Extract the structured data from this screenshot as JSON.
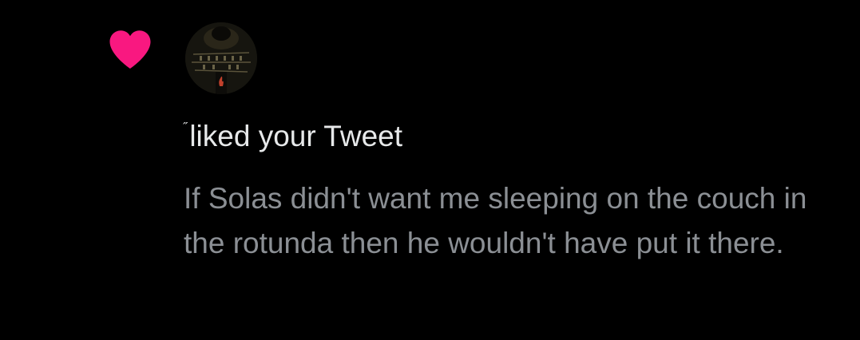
{
  "colors": {
    "heart": "#f91880",
    "primary_text": "#e7e9ea",
    "secondary_text": "#8b8f94",
    "background": "#000000"
  },
  "notification": {
    "icon": "heart-icon",
    "avatar": "user-avatar",
    "username_fragment": "˝",
    "action_text": "liked your Tweet",
    "tweet_text": "If Solas didn't want me sleeping on the couch in the rotunda then he wouldn't have put it there."
  }
}
